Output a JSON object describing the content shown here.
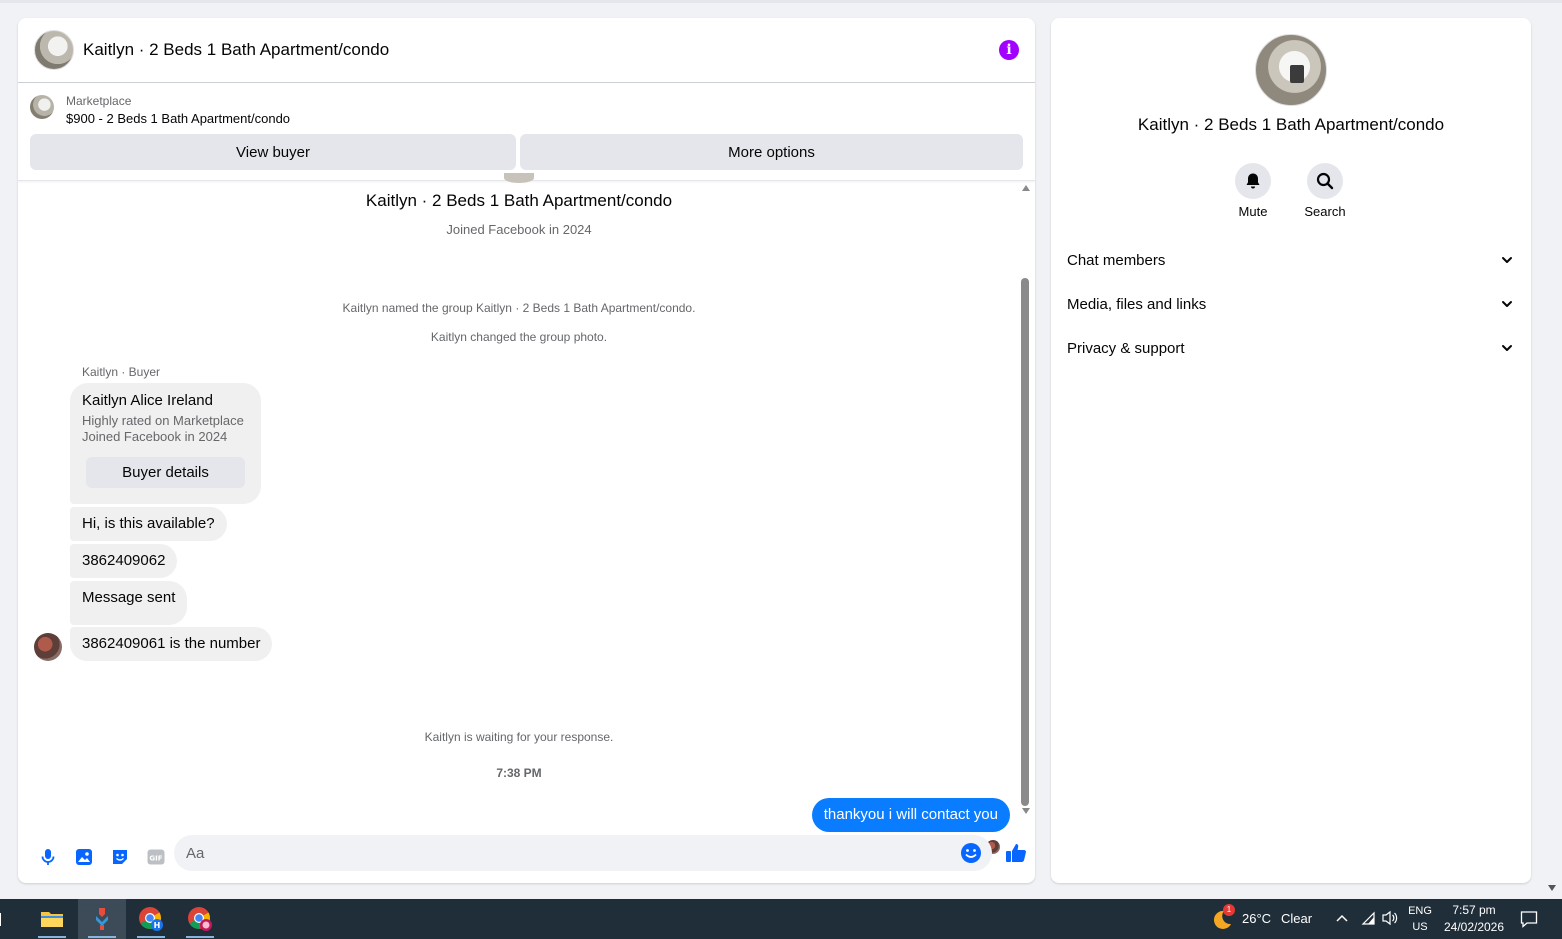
{
  "header": {
    "title": "Kaitlyn · 2 Beds 1 Bath Apartment/condo",
    "info_icon": "i"
  },
  "listing": {
    "label": "Marketplace",
    "price_title": "$900 - 2 Beds 1 Bath Apartment/condo",
    "view_buyer": "View buyer",
    "more_options": "More options"
  },
  "thread": {
    "group_name": "Kaitlyn · 2 Beds 1 Bath Apartment/condo",
    "joined": "Joined Facebook in 2024",
    "system_1": "Kaitlyn named the group Kaitlyn · 2 Beds 1 Bath Apartment/condo.",
    "system_2": "Kaitlyn changed the group photo.",
    "sender_label": "Kaitlyn · Buyer",
    "buyer_card": {
      "name": "Kaitlyn Alice Ireland",
      "line1": "Highly rated on Marketplace",
      "line2": "Joined Facebook in 2024",
      "button": "Buyer details"
    },
    "messages": [
      "Hi, is this available?",
      "3862409062",
      "Message sent",
      "3862409061 is the number"
    ],
    "waiting": "Kaitlyn is waiting for your response.",
    "time": "7:38 PM",
    "my_message": "thankyou i will contact you"
  },
  "composer": {
    "placeholder": "Aa"
  },
  "info_panel": {
    "title": "Kaitlyn · 2 Beds 1 Bath Apartment/condo",
    "mute": "Mute",
    "search": "Search",
    "sections": [
      "Chat members",
      "Media, files and links",
      "Privacy & support"
    ]
  },
  "taskbar": {
    "weather_temp": "26°C",
    "weather_desc": "Clear",
    "weather_badge": "1",
    "lang_1": "ENG",
    "lang_2": "US",
    "time": "7:57 pm",
    "date": "24/02/2026",
    "chrome_badge": "H"
  },
  "colors": {
    "accent": "#0a7cff",
    "info": "#a200ff",
    "taskbar": "#1f2e39"
  }
}
